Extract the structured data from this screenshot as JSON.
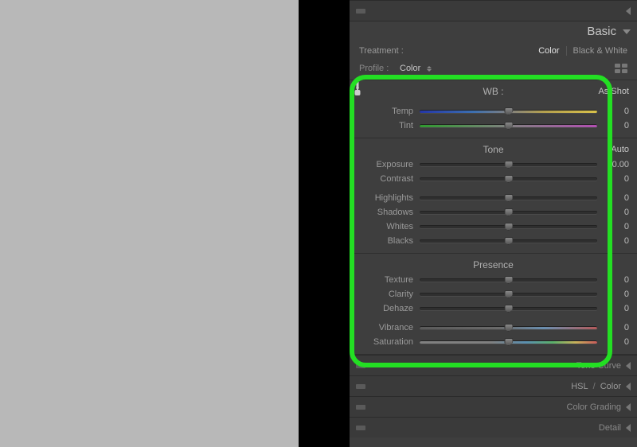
{
  "panels": {
    "top_collapsed": "",
    "basic": {
      "title": "Basic",
      "treatment": {
        "label": "Treatment :",
        "color": "Color",
        "bw": "Black & White"
      },
      "profile": {
        "label": "Profile :",
        "value": "Color"
      },
      "wb": {
        "title": "WB :",
        "value": "As Shot",
        "sliders": [
          {
            "label": "Temp",
            "value": "0",
            "type": "temp"
          },
          {
            "label": "Tint",
            "value": "0",
            "type": "tint"
          }
        ]
      },
      "tone": {
        "title": "Tone",
        "auto": "Auto",
        "groupA": [
          {
            "label": "Exposure",
            "value": "0.00"
          },
          {
            "label": "Contrast",
            "value": "0"
          }
        ],
        "groupB": [
          {
            "label": "Highlights",
            "value": "0"
          },
          {
            "label": "Shadows",
            "value": "0"
          },
          {
            "label": "Whites",
            "value": "0"
          },
          {
            "label": "Blacks",
            "value": "0"
          }
        ]
      },
      "presence": {
        "title": "Presence",
        "groupA": [
          {
            "label": "Texture",
            "value": "0"
          },
          {
            "label": "Clarity",
            "value": "0"
          },
          {
            "label": "Dehaze",
            "value": "0"
          }
        ],
        "groupB": [
          {
            "label": "Vibrance",
            "value": "0",
            "type": "vib"
          },
          {
            "label": "Saturation",
            "value": "0",
            "type": "sat"
          }
        ]
      }
    },
    "collapsed": {
      "tone_curve": "Tone Curve",
      "hsl": {
        "a": "HSL",
        "sep": " / ",
        "b": "Color"
      },
      "color_grading": "Color Grading",
      "detail": "Detail"
    }
  }
}
